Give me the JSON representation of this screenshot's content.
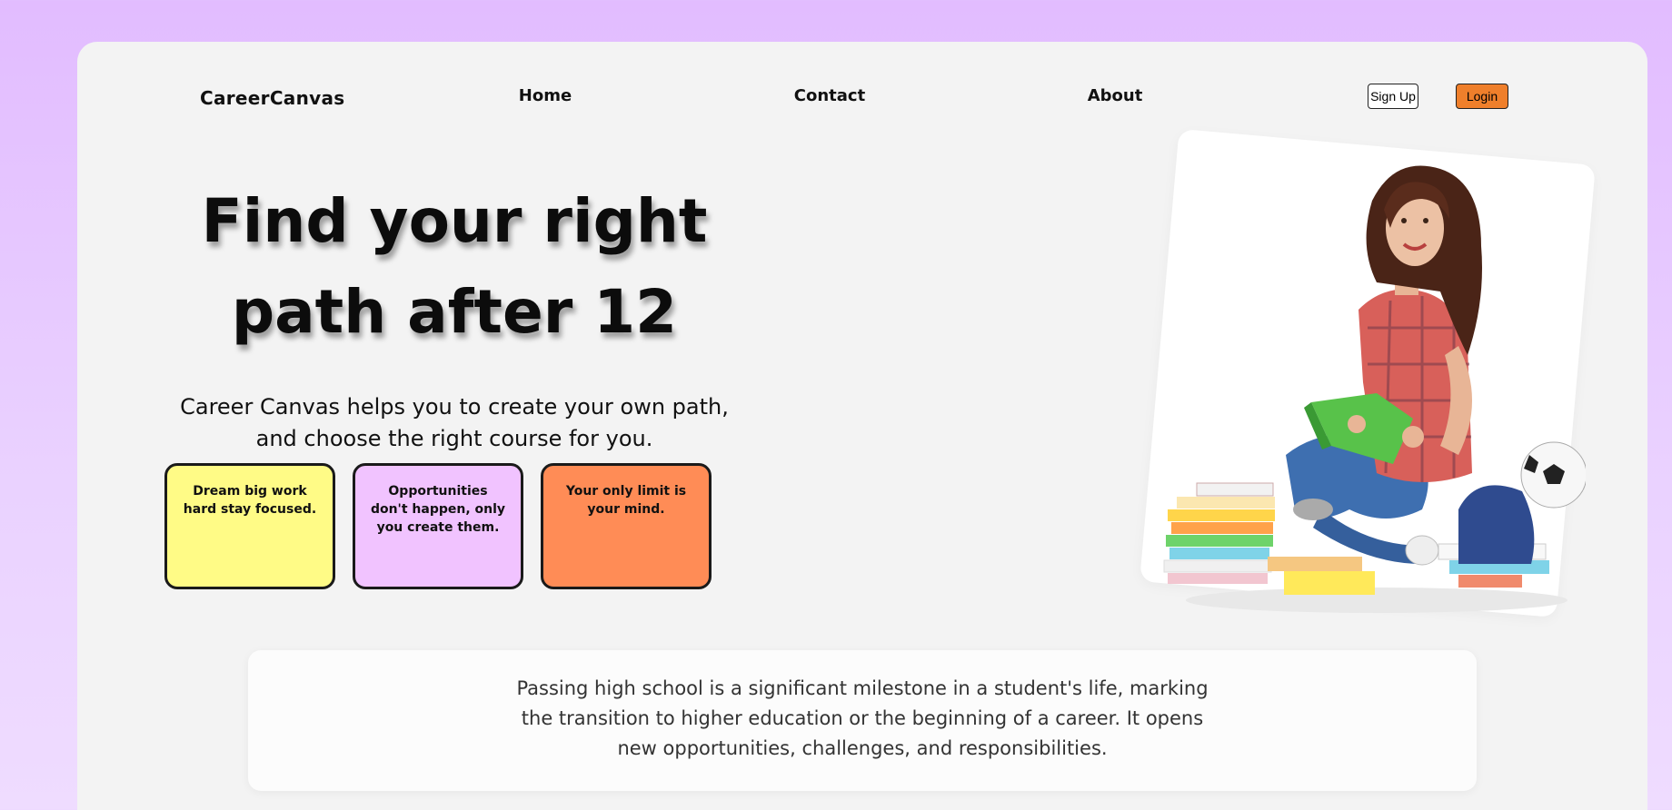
{
  "nav": {
    "logo": "CareerCanvas",
    "links": [
      "Home",
      "Contact",
      "About"
    ],
    "signup_label": "Sign Up",
    "login_label": "Login"
  },
  "hero": {
    "title_line1": "Find your right",
    "title_line2": "path after 12",
    "subtitle_line1": "Career Canvas helps you to create your own path,",
    "subtitle_line2": "and choose the right course for you."
  },
  "quotes": [
    {
      "text": "Dream big work hard stay focused.",
      "color": "#fffb86"
    },
    {
      "text": "Opportunities don't happen, only you create them.",
      "color": "#f1c3ff"
    },
    {
      "text": "Your only limit is your mind.",
      "color": "#ff8c56"
    }
  ],
  "info": {
    "text": "Passing high school is a significant milestone in a student's life, marking the transition to higher education or the beginning of a career. It opens new opportunities, challenges, and responsibilities."
  },
  "colors": {
    "background": "#e2bcff",
    "accent": "#ef7f2b"
  }
}
